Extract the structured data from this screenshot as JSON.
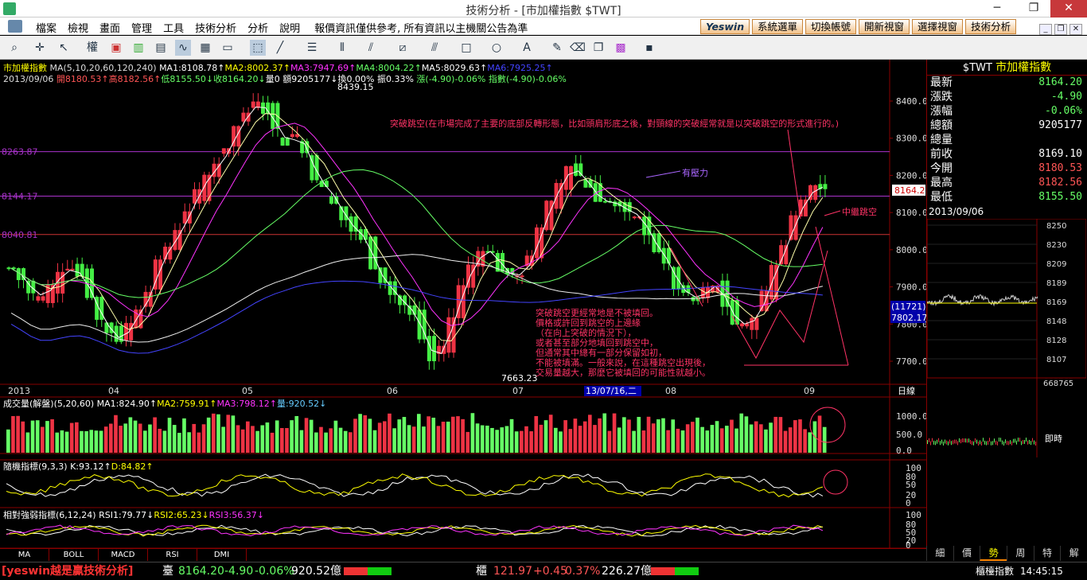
{
  "window": {
    "title": "技術分析 - [市加權指數 $TWT]",
    "controls": [
      "─",
      "❐",
      "✕"
    ]
  },
  "menu": {
    "items": [
      "檔案",
      "檢視",
      "畫面",
      "管理",
      "工具",
      "技術分析",
      "分析",
      "說明"
    ],
    "notice": "報價資訊僅供參考, 所有資訊以主機關公告為準"
  },
  "top_buttons": {
    "logo": "Yeswin",
    "items": [
      "系統選單",
      "切換帳號",
      "開新視窗",
      "選擇視窗",
      "技術分析"
    ]
  },
  "toolbar_icons": [
    "zoom-icon",
    "crosshair-icon",
    "pointer-icon",
    "bar-type-icon",
    "price-icon",
    "candle-icon",
    "line-chart-icon",
    "chart-icon",
    "overlay-icon",
    "draw-select-icon",
    "trendline-icon",
    "horizontal-line-icon",
    "vertical-line-icon",
    "fan-icon",
    "channel-icon",
    "parallel-icon",
    "rectangle-icon",
    "ellipse-icon",
    "text-icon",
    "eraser-icon",
    "copy-icon",
    "grid-icon",
    "save-icon"
  ],
  "toolbar_label": "權",
  "main_chart": {
    "info1": [
      {
        "t": "市加權指數",
        "c": "#ff0"
      },
      {
        "t": " MA(5,10,20,60,120,240) ",
        "c": "#ddd"
      },
      {
        "t": "MA1:8108.78↑",
        "c": "#fff"
      },
      {
        "t": "MA2:8002.37↑",
        "c": "#ff0"
      },
      {
        "t": "MA3:7947.69↑",
        "c": "#f3f"
      },
      {
        "t": "MA4:8004.22↑",
        "c": "#6f6"
      },
      {
        "t": "MA5:8029.63↑",
        "c": "#fff"
      },
      {
        "t": "MA6:7925.25↑",
        "c": "#44f"
      }
    ],
    "info2": [
      {
        "t": "2013/09/06 ",
        "c": "#ddd"
      },
      {
        "t": "開8180.53↑",
        "c": "#f55"
      },
      {
        "t": "高8182.56↑",
        "c": "#f55"
      },
      {
        "t": "低8155.50↓",
        "c": "#6f6"
      },
      {
        "t": "收8164.20↓",
        "c": "#6f6"
      },
      {
        "t": "量0 ",
        "c": "#fff"
      },
      {
        "t": "額9205177↓",
        "c": "#fff"
      },
      {
        "t": "換0.00% ",
        "c": "#fff"
      },
      {
        "t": "振0.33% ",
        "c": "#fff"
      },
      {
        "t": "漲(-4.90)-0.06% ",
        "c": "#6f6"
      },
      {
        "t": "指數(-4.90)-0.06%",
        "c": "#6f6"
      }
    ],
    "y_ticks": [
      "8400.0",
      "8300.0",
      "8200.0",
      "8100.0",
      "8000.0",
      "7900.0",
      "7800.0",
      "7700.0"
    ],
    "h_levels": [
      "8263.87",
      "8144.17",
      "8040.81"
    ],
    "peak_label": "8439.15",
    "low_label": "7663.23",
    "current_label": "8164.2",
    "ma_label": "7802.17",
    "count_label": "(11721)",
    "x_labels": [
      "2013",
      "04",
      "05",
      "06",
      "07",
      "08",
      "09"
    ],
    "cursor_date": "13/07/16,二",
    "period": "日線",
    "annotations": {
      "breakaway": "突破跳空(在市場完成了主要的底部反轉形態，比如頭肩形底之後，對頸線的突破經常就是以突破跳空的形式進行的。)",
      "pressure": "有壓力",
      "mid_gap": "中繼跳空",
      "gap_text": [
        "突破跳空更經常地是不被填回。",
        "價格或許回到跳空的上邊緣",
        "（在向上突破的情況下），",
        "或者甚至部分地填回到跳空中，",
        "但通常其中總有一部分保留如初，",
        "不能被填滿。一般來說，在這種跳空出現後，",
        "交易量越大，那麼它被填回的可能性就越小。"
      ]
    }
  },
  "volume_panel": {
    "info": [
      {
        "t": "成交量(解盤)(5,20,60) ",
        "c": "#fff"
      },
      {
        "t": "MA1:824.90↑",
        "c": "#fff"
      },
      {
        "t": "MA2:759.91↑",
        "c": "#ff0"
      },
      {
        "t": "MA3:798.12↑",
        "c": "#f3f"
      },
      {
        "t": "量:920.52↓",
        "c": "#6cf"
      }
    ],
    "y_ticks": [
      "1000.0",
      "500.0",
      "0.0"
    ]
  },
  "kd_panel": {
    "info": [
      {
        "t": "隨機指標(9,3,3) ",
        "c": "#fff"
      },
      {
        "t": "K:93.12↑",
        "c": "#fff"
      },
      {
        "t": "D:84.82↑",
        "c": "#ff0"
      }
    ],
    "y_ticks": [
      "100",
      "80",
      "50",
      "20",
      "0"
    ]
  },
  "rsi_panel": {
    "info": [
      {
        "t": "相對強弱指標(6,12,24) ",
        "c": "#fff"
      },
      {
        "t": "RSI1:79.77↓",
        "c": "#fff"
      },
      {
        "t": "RSI2:65.23↓",
        "c": "#ff0"
      },
      {
        "t": "RSI3:56.37↓",
        "c": "#f3f"
      }
    ],
    "y_ticks": [
      "100",
      "80",
      "50",
      "20",
      "0"
    ]
  },
  "indicator_tabs": [
    "MA",
    "BOLL",
    "MACD",
    "RSI",
    "DMI"
  ],
  "quote": {
    "code": "$TWT",
    "name": "市加權指數",
    "rows": [
      {
        "k": "最新",
        "v": "8164.20",
        "c": "#6f6"
      },
      {
        "k": "漲跌",
        "v": "-4.90",
        "c": "#6f6"
      },
      {
        "k": "漲幅",
        "v": "-0.06%",
        "c": "#6f6"
      },
      {
        "k": "總額",
        "v": "9205177",
        "c": "#fff"
      },
      {
        "k": "總量",
        "v": "",
        "c": "#fff"
      },
      {
        "k": "前收",
        "v": "8169.10",
        "c": "#fff"
      },
      {
        "k": "今開",
        "v": "8180.53",
        "c": "#f55"
      },
      {
        "k": "最高",
        "v": "8182.56",
        "c": "#f55"
      },
      {
        "k": "最低",
        "v": "8155.50",
        "c": "#6f6"
      }
    ],
    "date": "2013/09/06",
    "intraday_ticks": [
      "8250",
      "8230",
      "8209",
      "8189",
      "8169",
      "8148",
      "8128",
      "8107"
    ],
    "intraday_vol": "668765",
    "realtime": "即時",
    "tabs": [
      "細",
      "價",
      "勢",
      "周",
      "特",
      "解"
    ],
    "active_tab": "勢"
  },
  "status": {
    "brand": "[yeswin越是贏技術分析]",
    "idx_label": "臺",
    "idx_value": "8164.20",
    "idx_change": "-4.90",
    "idx_pct": "-0.06%",
    "idx_vol": "920.52億",
    "otc_label": "櫃",
    "otc_value": "121.97",
    "otc_change": "+0.45",
    "otc_pct": "0.37%",
    "otc_vol": "226.27億",
    "right_label": "櫃檯指數",
    "time": "14:45:15"
  },
  "colors": {
    "up": "#f55",
    "down": "#6f6",
    "accent": "#ff0",
    "grid": "#800"
  }
}
